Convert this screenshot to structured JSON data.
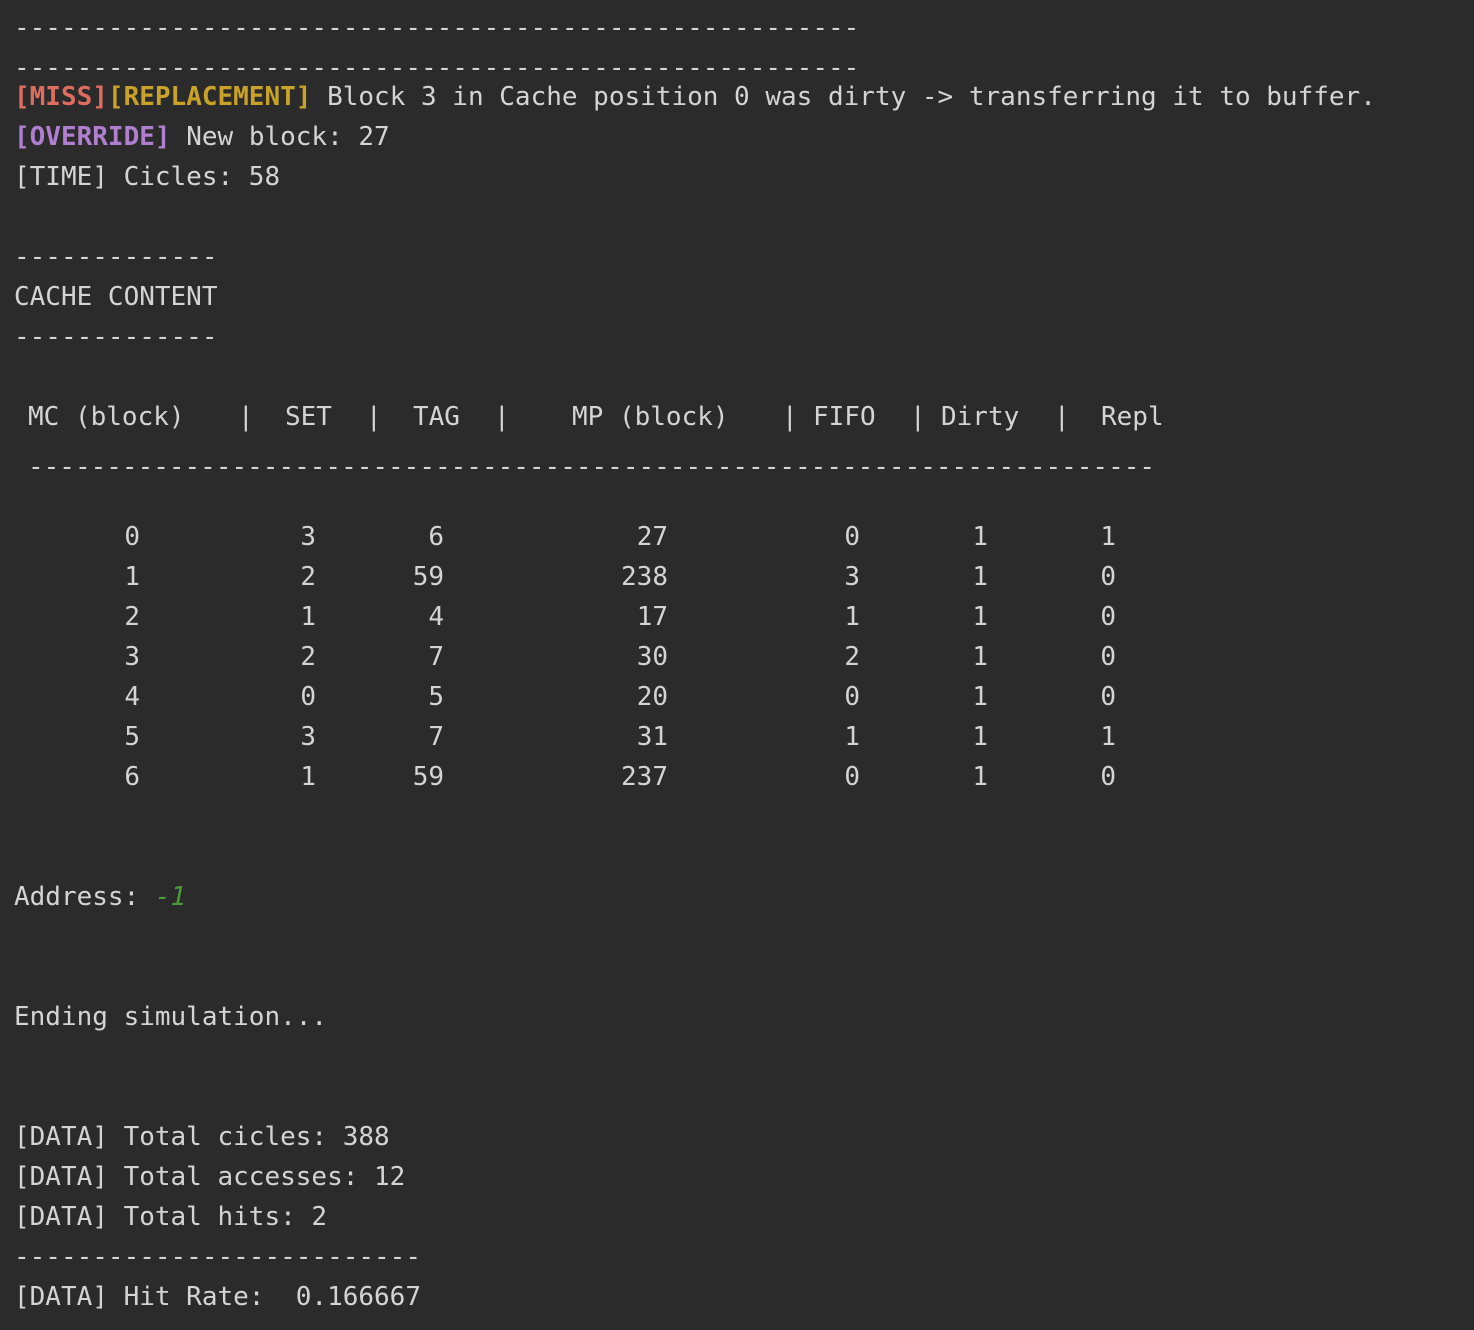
{
  "terminal": {
    "dash_line_1": "------------------------------------------------------",
    "dash_line_2": "------------------------------------------------------",
    "miss_tag": "[MISS]",
    "replacement_tag": "[REPLACEMENT]",
    "replacement_msg": " Block 3 in Cache position 0 was dirty -> transferring it to buffer.",
    "override_tag": "[OVERRIDE]",
    "override_msg": " New block: 27",
    "time_line": "[TIME] Cicles: 58",
    "cache_dash_top": "-------------",
    "cache_title": "CACHE CONTENT",
    "cache_dash_bottom": "-------------",
    "table": {
      "headers": [
        "MC (block)",
        "SET",
        "TAG",
        "MP (block)",
        "FIFO",
        "Dirty",
        "Repl"
      ],
      "separator": "|",
      "rule": "------------------------------------------------------------------------",
      "rows": [
        [
          "0",
          "3",
          "6",
          "27",
          "0",
          "1",
          "1"
        ],
        [
          "1",
          "2",
          "59",
          "238",
          "3",
          "1",
          "0"
        ],
        [
          "2",
          "1",
          "4",
          "17",
          "1",
          "1",
          "0"
        ],
        [
          "3",
          "2",
          "7",
          "30",
          "2",
          "1",
          "0"
        ],
        [
          "4",
          "0",
          "5",
          "20",
          "0",
          "1",
          "0"
        ],
        [
          "5",
          "3",
          "7",
          "31",
          "1",
          "1",
          "1"
        ],
        [
          "6",
          "1",
          "59",
          "237",
          "0",
          "1",
          "0"
        ]
      ]
    },
    "address_label": "Address: ",
    "address_value": "-1",
    "ending": "Ending simulation...",
    "total_cicles": "[DATA] Total cicles: 388",
    "total_accesses": "[DATA] Total accesses: 12",
    "total_hits": "[DATA] Total hits: 2",
    "final_dash": "--------------------------",
    "hit_rate": "[DATA] Hit Rate:  0.166667"
  }
}
